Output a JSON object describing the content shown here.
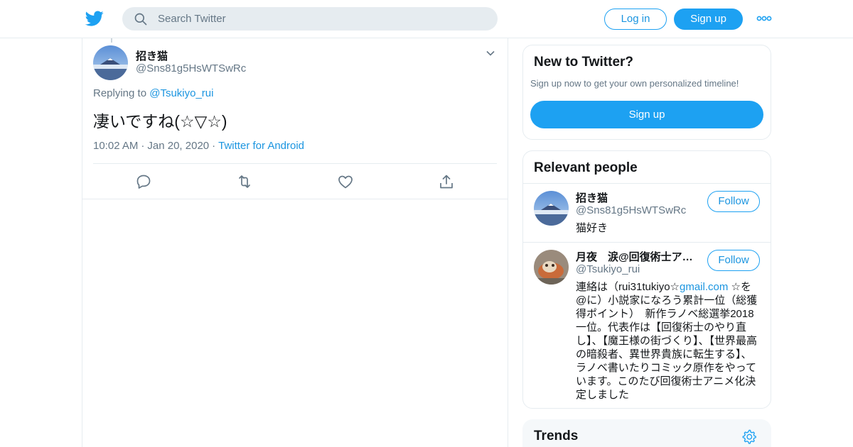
{
  "header": {
    "search_placeholder": "Search Twitter",
    "login_label": "Log in",
    "signup_label": "Sign up"
  },
  "tweet": {
    "author_name": "招き猫",
    "author_handle": "@Sns81g5HsWTSwRc",
    "replying_prefix": "Replying to",
    "replying_to": "@Tsukiyo_rui",
    "text": "凄いですね(☆▽☆)",
    "time": "10:02 AM",
    "date": "Jan 20, 2020",
    "source": "Twitter for Android"
  },
  "sidebar": {
    "new_title": "New to Twitter?",
    "new_subtitle": "Sign up now to get your own personalized timeline!",
    "new_signup_label": "Sign up",
    "people_title": "Relevant people",
    "people": [
      {
        "name": "招き猫",
        "handle": "@Sns81g5HsWTSwRc",
        "bio": "猫好き",
        "follow_label": "Follow"
      },
      {
        "name": "月夜　涙@回復術士ア…",
        "handle": "@Tsukiyo_rui",
        "bio_before": "連絡は（rui31tukiyo☆",
        "bio_link": "gmail.com",
        "bio_after": " ☆を@に）小説家になろう累計一位（総獲得ポイント）　新作ラノベ総選挙2018一位。代表作は【回復術士のやり直し】、【魔王様の街づくり】、【世界最高の暗殺者、異世界貴族に転生する】、ラノベ書いたりコミック原作をやっています。このたび回復術士アニメ化決定しました",
        "follow_label": "Follow"
      }
    ],
    "trends_title": "Trends"
  },
  "colors": {
    "brand": "#1da1f2",
    "link": "#1b95e0",
    "secondary_text": "#657786",
    "border": "#e6ecf0"
  },
  "icons": {
    "logo": "twitter-bird-icon",
    "search": "search-icon",
    "more": "more-dots-icon",
    "caret": "chevron-down-icon",
    "reply": "reply-icon",
    "retweet": "retweet-icon",
    "like": "heart-icon",
    "share": "share-icon",
    "settings": "gear-icon"
  }
}
